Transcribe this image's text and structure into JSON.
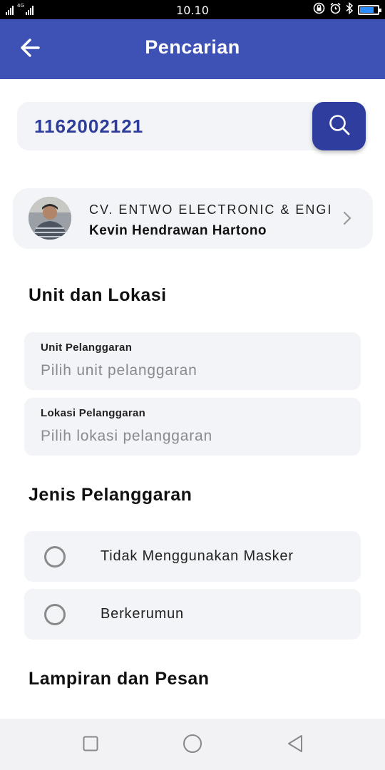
{
  "status_bar": {
    "signal_tag": "4G",
    "time": "10.10"
  },
  "app_bar": {
    "title": "Pencarian",
    "back_icon": "arrow-left-icon"
  },
  "search": {
    "value": "1162002121",
    "button_icon": "search-icon"
  },
  "profile": {
    "company": "CV. ENTWO ELECTRONIC & ENGI",
    "name": "Kevin Hendrawan Hartono",
    "chevron_icon": "chevron-right-icon"
  },
  "unit_section": {
    "title": "Unit dan Lokasi",
    "unit_field": {
      "label": "Unit Pelanggaran",
      "placeholder": "Pilih unit pelanggaran"
    },
    "location_field": {
      "label": "Lokasi Pelanggaran",
      "placeholder": "Pilih lokasi pelanggaran"
    }
  },
  "violation_section": {
    "title": "Jenis Pelanggaran",
    "options": [
      {
        "label": "Tidak Menggunakan Masker",
        "selected": false
      },
      {
        "label": "Berkerumun",
        "selected": false
      }
    ]
  },
  "attachment_section": {
    "title": "Lampiran dan Pesan"
  },
  "colors": {
    "primary": "#3e51b5",
    "search_button": "#2f3e9e",
    "card_bg": "#f3f4f8"
  }
}
